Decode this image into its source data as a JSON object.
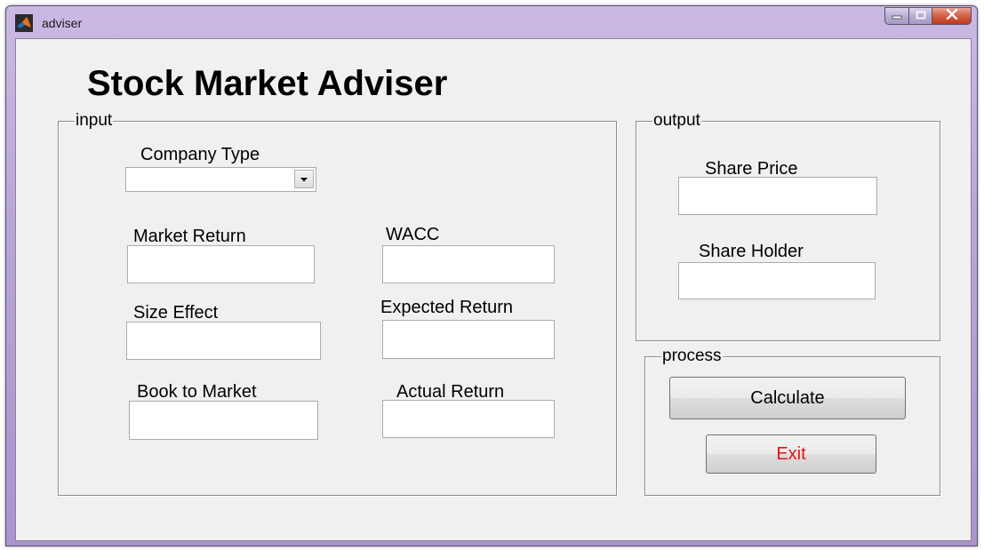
{
  "window": {
    "title": "adviser"
  },
  "heading": "Stock Market Adviser",
  "input_panel": {
    "title": "input",
    "company_type": {
      "label": "Company Type",
      "value": ""
    },
    "market_return": {
      "label": "Market Return",
      "value": ""
    },
    "wacc": {
      "label": "WACC",
      "value": ""
    },
    "size_effect": {
      "label": "Size Effect",
      "value": ""
    },
    "expected_return": {
      "label": "Expected Return",
      "value": ""
    },
    "book_to_market": {
      "label": "Book to Market",
      "value": ""
    },
    "actual_return": {
      "label": "Actual Return",
      "value": ""
    }
  },
  "output_panel": {
    "title": "output",
    "share_price": {
      "label": "Share Price",
      "value": ""
    },
    "share_holder": {
      "label": "Share Holder",
      "value": ""
    }
  },
  "process_panel": {
    "title": "process",
    "calculate_label": "Calculate",
    "exit_label": "Exit"
  },
  "icons": {
    "app": "matlab-logo-icon",
    "minimize": "minimize-icon",
    "maximize": "maximize-icon",
    "close": "close-icon",
    "dropdown": "chevron-down-icon"
  },
  "colors": {
    "exit_text": "#e81010",
    "client_bg": "#f0f0f0"
  }
}
